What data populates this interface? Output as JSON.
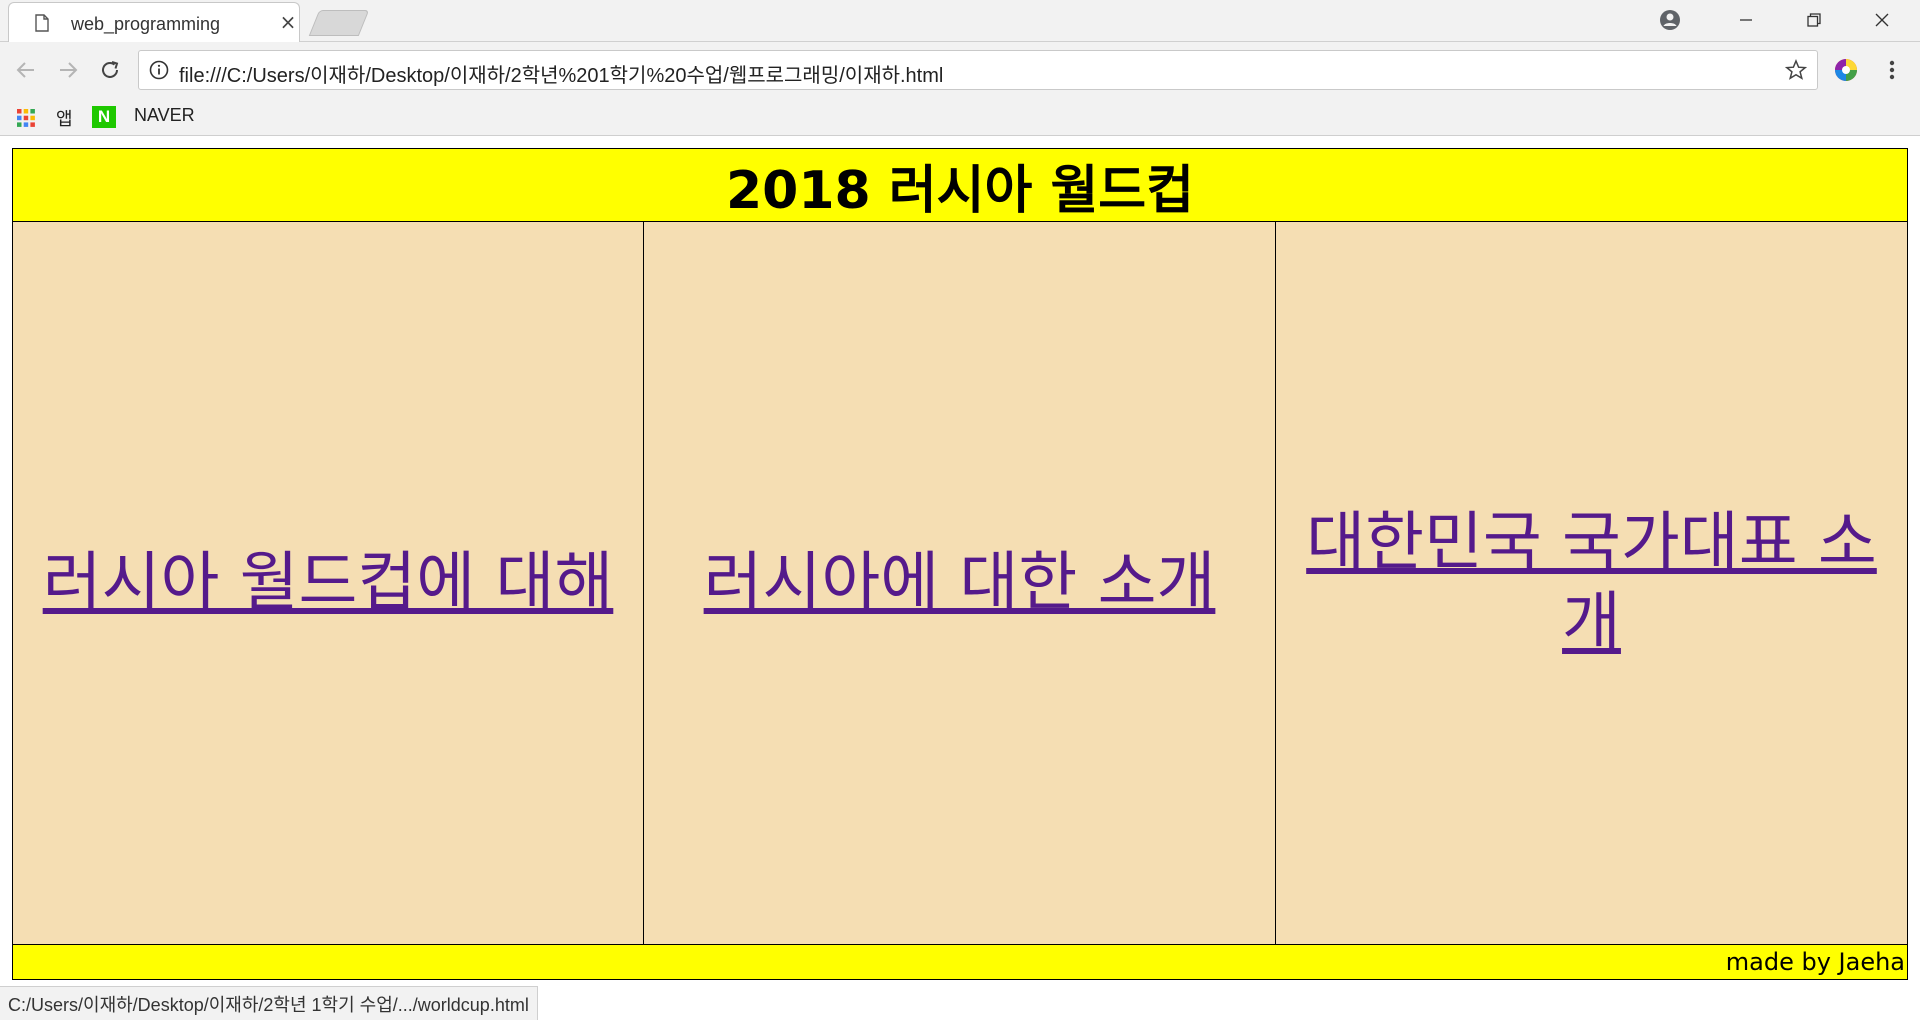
{
  "browser": {
    "tab_title": "web_programming",
    "tab_close": "×",
    "url": "file:///C:/Users/이재하/Desktop/이재하/2학년%201학기%20수업/웹프로그래밍/이재하.html",
    "bookmarks": [
      {
        "label": "앱",
        "icon": "apps-grid-icon"
      },
      {
        "label": "NAVER",
        "icon": "naver-icon",
        "icon_letter": "N",
        "icon_color": "#1ec800"
      }
    ],
    "status_url": "C:/Users/이재하/Desktop/이재하/2학년 1학기 수업/.../worldcup.html"
  },
  "page": {
    "title": "2018 러시아 월드컵",
    "links": [
      {
        "label": "러시아 월드컵에 대해"
      },
      {
        "label": "러시아에 대한 소개"
      },
      {
        "label": "대한민국 국가대표 소개"
      }
    ],
    "footer": "made by Jaeha"
  },
  "colors": {
    "header_bg": "#ffff00",
    "cell_bg": "#f5deb3",
    "link": "#551a8b"
  }
}
